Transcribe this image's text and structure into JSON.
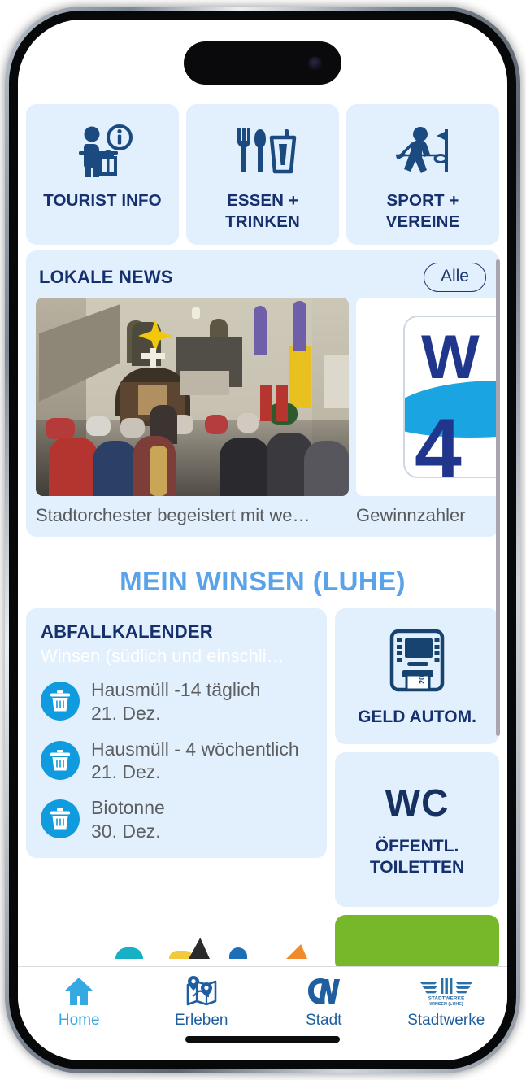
{
  "brand": {
    "navy": "#16306e",
    "light_blue_card": "#e2f0fd",
    "accent_blue": "#36a9e1",
    "title_blue": "#5aa3e8",
    "green": "#76b82a",
    "trash_blue": "#119bdf"
  },
  "quick_tiles": [
    {
      "label": "TOURIST INFO",
      "icon": "tourist-info-icon"
    },
    {
      "label": "ESSEN +\nTRINKEN",
      "label_line1": "ESSEN +",
      "label_line2": "TRINKEN",
      "icon": "cutlery-glass-icon"
    },
    {
      "label": "SPORT +\nVEREINE",
      "label_line1": "SPORT +",
      "label_line2": "VEREINE",
      "icon": "golfer-icon"
    }
  ],
  "news": {
    "title": "LOKALE NEWS",
    "all_button": "Alle",
    "cards": [
      {
        "caption": "Stadtorchester begeistert mit we…",
        "image": "church-concert-photo"
      },
      {
        "caption": "Gewinnzahler",
        "image": "w4-logo-graphic"
      }
    ]
  },
  "section": {
    "title": "MEIN WINSEN (LUHE)"
  },
  "abfallkalender": {
    "title": "ABFALLKALENDER",
    "subtitle": "Winsen (südlich und einschli…",
    "items": [
      {
        "name": "Hausmüll -14 täglich",
        "date": "21. Dez.",
        "icon": "trash-icon"
      },
      {
        "name": "Hausmüll - 4 wöchentlich",
        "date": "21. Dez.",
        "icon": "trash-icon"
      },
      {
        "name": "Biotonne",
        "date": "30. Dez.",
        "icon": "trash-icon"
      }
    ]
  },
  "side_cards": {
    "atm": {
      "label": "GELD AUTOM.",
      "icon": "atm-icon"
    },
    "wc": {
      "big": "WC",
      "line1": "ÖFFENTL.",
      "line2": "TOILETTEN",
      "icon": "wc-icon"
    }
  },
  "bottom_nav": [
    {
      "label": "Home",
      "icon": "home-icon",
      "active": true
    },
    {
      "label": "Erleben",
      "icon": "map-pins-icon",
      "active": false
    },
    {
      "label": "Stadt",
      "icon": "cw-logo-icon",
      "active": false
    },
    {
      "label": "Stadtwerke",
      "icon": "stadtwerke-logo-icon",
      "active": false
    }
  ],
  "stadtwerke_logo": {
    "line1": "STADTWERKE",
    "line2": "WINSEN (LUHE)"
  }
}
